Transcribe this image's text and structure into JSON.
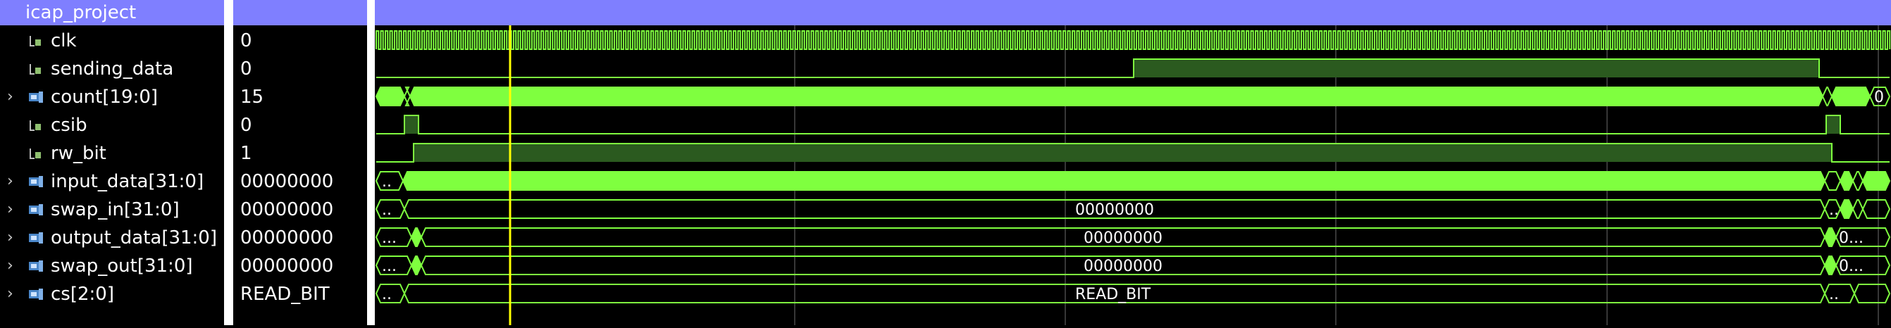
{
  "header": {
    "title": "icap_project"
  },
  "signals": [
    {
      "name": "clk",
      "value": "0",
      "expandable": false,
      "icon": "scalar-signal-icon"
    },
    {
      "name": "sending_data",
      "value": "0",
      "expandable": false,
      "icon": "scalar-signal-icon"
    },
    {
      "name": "count[19:0]",
      "value": "15",
      "expandable": true,
      "icon": "bus-signal-icon"
    },
    {
      "name": "csib",
      "value": "0",
      "expandable": false,
      "icon": "scalar-signal-icon"
    },
    {
      "name": "rw_bit",
      "value": "1",
      "expandable": false,
      "icon": "scalar-signal-icon"
    },
    {
      "name": "input_data[31:0]",
      "value": "00000000",
      "expandable": true,
      "icon": "bus-signal-icon"
    },
    {
      "name": "swap_in[31:0]",
      "value": "00000000",
      "expandable": true,
      "icon": "bus-signal-icon"
    },
    {
      "name": "output_data[31:0]",
      "value": "00000000",
      "expandable": true,
      "icon": "bus-signal-icon"
    },
    {
      "name": "swap_out[31:0]",
      "value": "00000000",
      "expandable": true,
      "icon": "bus-signal-icon"
    },
    {
      "name": "cs[2:0]",
      "value": "READ_BIT",
      "expandable": true,
      "icon": "bus-signal-icon"
    }
  ],
  "wave_labels": {
    "swap_in": {
      "start": "..",
      "mid": "00000000",
      "end": ".."
    },
    "output_data": {
      "start": "...",
      "mid": "00000000",
      "end": "0..."
    },
    "swap_out": {
      "start": "...",
      "mid": "00000000",
      "end": "0..."
    },
    "cs": {
      "start": "..",
      "mid": "READ_BIT",
      "end": ".."
    },
    "count": {
      "end": "0"
    },
    "input_data": {
      "start": ".."
    }
  },
  "colors": {
    "waveform": "#7fff3f",
    "high_fill": "#2b5a1f",
    "cursor": "#ffff00",
    "header": "#7f7fff",
    "grid": "#6e6e6e"
  }
}
